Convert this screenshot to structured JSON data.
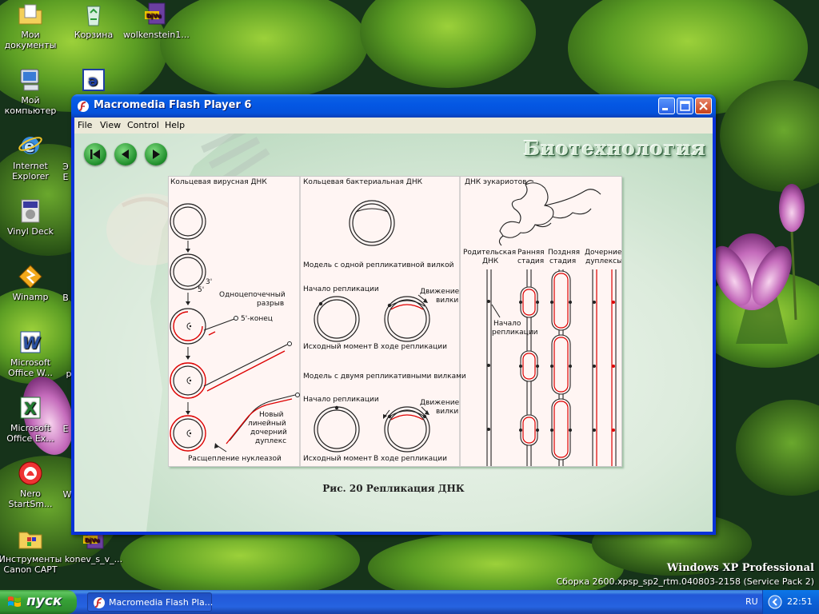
{
  "desktop": {
    "icons": [
      {
        "label": "Мои документы",
        "icon": "folder-documents-icon"
      },
      {
        "label": "Корзина",
        "icon": "recycle-bin-icon"
      },
      {
        "label": "wolkenstein1...",
        "icon": "djvu-file-icon"
      },
      {
        "label": "Мой компьютер",
        "icon": "my-computer-icon"
      },
      {
        "label": "",
        "icon": "app-e-icon"
      },
      {
        "label": "Internet Explorer",
        "icon": "internet-explorer-icon"
      },
      {
        "label": "Vinyl Deck",
        "icon": "vinyl-deck-icon"
      },
      {
        "label": "Winamp",
        "icon": "winamp-icon"
      },
      {
        "label": "Microsoft Office W...",
        "icon": "word-icon"
      },
      {
        "label": "Microsoft Office Ex...",
        "icon": "excel-icon"
      },
      {
        "label": "Nero StartSm...",
        "icon": "nero-icon"
      },
      {
        "label": "Инструменты Canon CAPT",
        "icon": "canon-tools-icon"
      },
      {
        "label": "konev_s_v_...",
        "icon": "djvu-file-icon"
      }
    ],
    "partial_labels": [
      "Э",
      "E",
      "B",
      "р",
      "E",
      "W"
    ],
    "os_name": "Windows XP Professional",
    "build": "Сборка 2600.xpsp_sp2_rtm.040803-2158 (Service Pack 2)"
  },
  "window": {
    "title": "Macromedia Flash Player 6",
    "menu": [
      "File",
      "View",
      "Control",
      "Help"
    ]
  },
  "flash": {
    "header": "Биотехнология",
    "nav": [
      "first-slide-icon",
      "previous-slide-icon",
      "next-slide-icon"
    ],
    "caption": "Рис. 20 Репликация ДНК",
    "col1": {
      "title": "Кольцевая вирусная ДНК",
      "three_prime": "3'",
      "five_prime": "5'",
      "nick1": "Одноцепочечный",
      "nick2": "разрыв",
      "five_end": "5'-конец",
      "new1": "Новый",
      "new2": "линейный",
      "new3": "дочерний",
      "new4": "дуплекс",
      "nuclease": "Расщепление нуклеазой"
    },
    "col2": {
      "title": "Кольцевая бактериальная ДНК",
      "model1": "Модель с одной репликативной вилкой",
      "start": "Начало репликации",
      "fork1": "Движение",
      "fork2": "вилки",
      "initial": "Исходный момент",
      "during": "В ходе репликации",
      "model2": "Модель с двумя репликативными вилками"
    },
    "col3": {
      "title": "ДНК эукариотов",
      "h_parent1": "Родительская",
      "h_parent2": "ДНК",
      "h_early1": "Ранняя",
      "h_early2": "стадия",
      "h_late1": "Поздняя",
      "h_late2": "стадия",
      "h_daughter1": "Дочерние",
      "h_daughter2": "дуплексы",
      "origin1": "Начало",
      "origin2": "репликации"
    }
  },
  "taskbar": {
    "start": "пуск",
    "task": "Macromedia Flash Pla...",
    "lang": "RU",
    "time": "22:51"
  }
}
